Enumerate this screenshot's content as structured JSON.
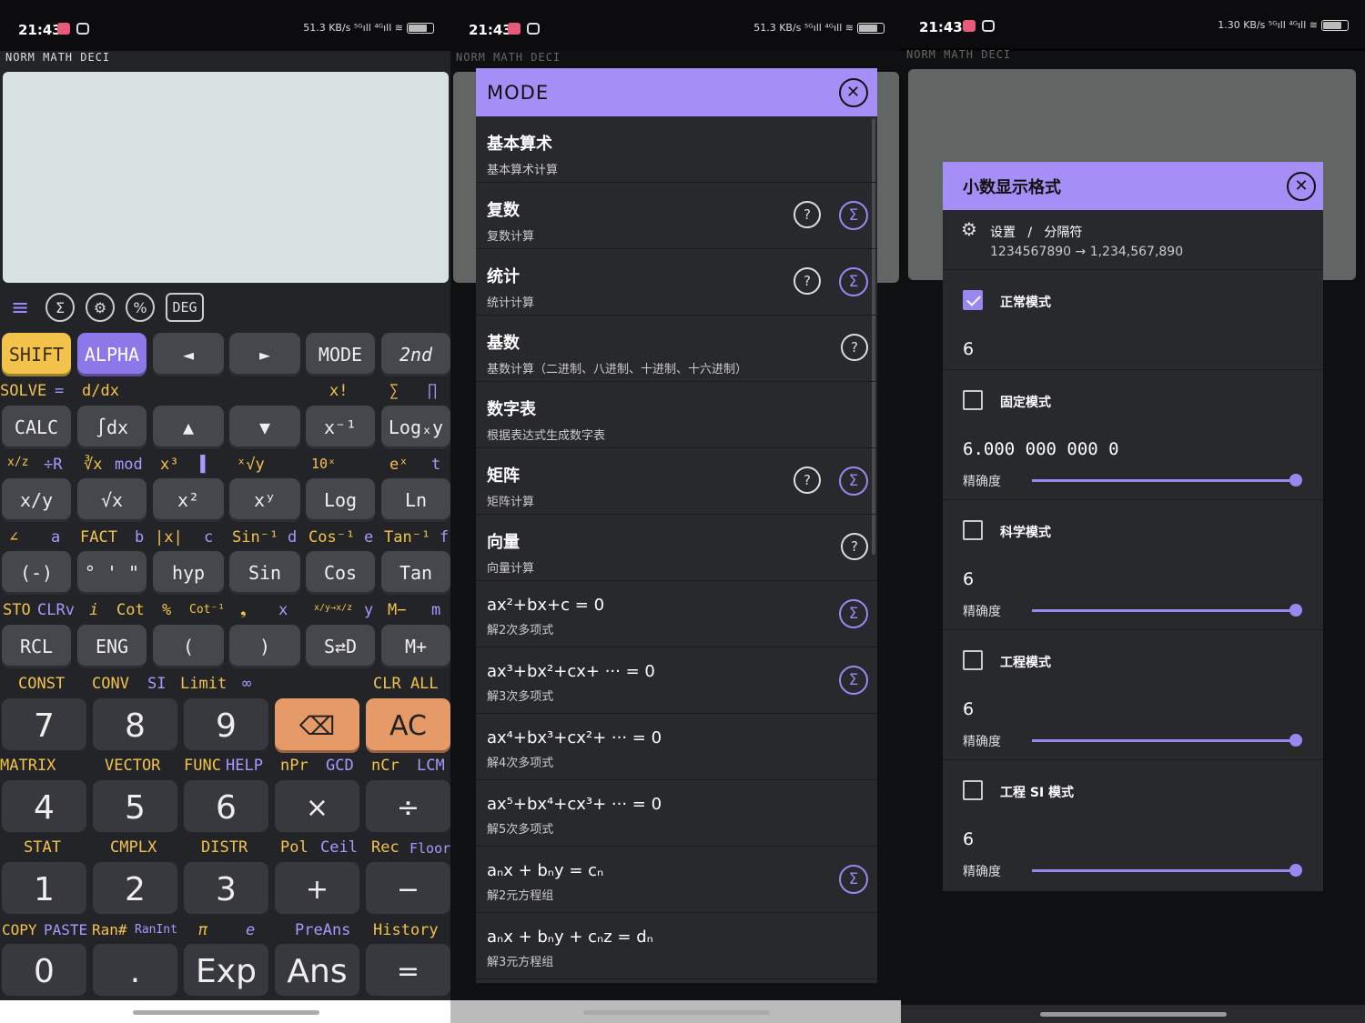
{
  "status": {
    "time": "21:43",
    "speed1": "51.3 KB/s",
    "speed3": "1.30 KB/s",
    "signal": "⁵ᴳıll ⁴ᴳıll ≋",
    "battery": "64"
  },
  "modes": "NORM  MATH  DECI",
  "colors": {
    "accent": "#a58ef5",
    "shift": "#f3c24b",
    "delete": "#e69a67",
    "alpha": "#8c78e8"
  },
  "toolbar": {
    "menu_icon": "menu-icon",
    "sigma_icon": "sigma-icon",
    "gear_icon": "gear-icon",
    "percent_icon": "percent-icon",
    "deg": "DEG"
  },
  "row1": {
    "shift": "SHIFT",
    "alpha": "ALPHA",
    "left": "◄",
    "right": "►",
    "mode": "MODE",
    "second": "2nd"
  },
  "row1_labels": {
    "solve": "SOLVE",
    "eq": "=",
    "ddx": "d/dx",
    "fact": "x!",
    "sum": "∑",
    "prod": "∏"
  },
  "row2": {
    "calc": "CALC",
    "int": "∫dx",
    "up": "▲",
    "down": "▼",
    "inv": "x⁻¹",
    "log": "Logₓy"
  },
  "row2_labels": {
    "frac": "x/z",
    "divr": "÷R",
    "cbrt": "∛x",
    "mod": "mod",
    "x3": "x³",
    "bar": "▐",
    "xrt": "ˣ√y",
    "ten": "10ˣ",
    "ex": "eˣ",
    "t": "t"
  },
  "row3": {
    "frac": "x/y",
    "sqrt": "√x",
    "sq": "x²",
    "pow": "xʸ",
    "log": "Log",
    "ln": "Ln"
  },
  "row3_labels": {
    "ang": "∠",
    "a": "a",
    "fact": "FACT",
    "b": "b",
    "abs": "|x|",
    "c": "c",
    "asin": "Sin⁻¹",
    "d": "d",
    "acos": "Cos⁻¹",
    "e": "e",
    "atan": "Tan⁻¹",
    "f": "f"
  },
  "row4": {
    "neg": "(-)",
    "deg": "° ' \"",
    "hyp": "hyp",
    "sin": "Sin",
    "cos": "Cos",
    "tan": "Tan"
  },
  "row4_labels": {
    "sto": "STO",
    "clrv": "CLRv",
    "i": "i",
    "cot": "Cot",
    "pct": "%",
    "acot": "Cot⁻¹",
    "comma": "❟",
    "x": "x",
    "conv": "x/y→x/z",
    "yv": "y",
    "mminus": "M−",
    "m": "m"
  },
  "row5": {
    "rcl": "RCL",
    "eng": "ENG",
    "lp": "(",
    "rp": ")",
    "sd": "S⇄D",
    "mplus": "M+"
  },
  "row5_labels": {
    "const": "CONST",
    "conv": "CONV",
    "si": "SI",
    "limit": "Limit",
    "inf": "∞",
    "clrall": "CLR ALL"
  },
  "num1": {
    "k7": "7",
    "k8": "8",
    "k9": "9",
    "del": "⌫",
    "ac": "AC"
  },
  "num1_labels": {
    "matrix": "MATRIX",
    "vector": "VECTOR",
    "func": "FUNC",
    "help": "HELP",
    "npr": "nPr",
    "gcd": "GCD",
    "ncr": "nCr",
    "lcm": "LCM"
  },
  "num2": {
    "k4": "4",
    "k5": "5",
    "k6": "6",
    "mul": "×",
    "div": "÷"
  },
  "num2_labels": {
    "stat": "STAT",
    "cmplx": "CMPLX",
    "distr": "DISTR",
    "pol": "Pol",
    "ceil": "Ceil",
    "rec": "Rec",
    "floor": "Floor"
  },
  "num3": {
    "k1": "1",
    "k2": "2",
    "k3": "3",
    "plus": "+",
    "minus": "−"
  },
  "num3_labels": {
    "copy": "COPY",
    "paste": "PASTE",
    "ran": "Ran#",
    "ranint": "RanInt",
    "pi": "π",
    "e": "e",
    "preans": "PreAns",
    "history": "History"
  },
  "num4": {
    "k0": "0",
    "dot": ".",
    "exp": "Exp",
    "ans": "Ans",
    "eq": "="
  },
  "mode_dialog": {
    "title": "MODE",
    "items": [
      {
        "title": "基本算术",
        "sub": "基本算术计算"
      },
      {
        "title": "复数",
        "sub": "复数计算"
      },
      {
        "title": "统计",
        "sub": "统计计算"
      },
      {
        "title": "基数",
        "sub": "基数计算（二进制、八进制、十进制、十六进制）"
      },
      {
        "title": "数字表",
        "sub": "根据表达式生成数字表"
      },
      {
        "title": "矩阵",
        "sub": "矩阵计算"
      },
      {
        "title": "向量",
        "sub": "向量计算"
      },
      {
        "title": "ax²+bx+c = 0",
        "sub": "解2次多项式"
      },
      {
        "title": "ax³+bx²+cx+ ··· = 0",
        "sub": "解3次多项式"
      },
      {
        "title": "ax⁴+bx³+cx²+ ··· = 0",
        "sub": "解4次多项式"
      },
      {
        "title": "ax⁵+bx⁴+cx³+ ··· = 0",
        "sub": "解5次多项式"
      },
      {
        "title": "aₙx + bₙy = cₙ",
        "sub": "解2元方程组"
      },
      {
        "title": "aₙx + bₙy + cₙz = dₙ",
        "sub": "解3元方程组"
      }
    ]
  },
  "decimal_dialog": {
    "title": "小数显示格式",
    "settings_path": "设置   /   分隔符",
    "separator_example": "1234567890 → 1,234,567,890",
    "precision_label": "精确度",
    "options": [
      {
        "label": "正常模式",
        "value": "6",
        "checked": true,
        "precision": 1.0
      },
      {
        "label": "固定模式",
        "value": "6.000 000 000 0",
        "checked": false,
        "precision": 1.0
      },
      {
        "label": "科学模式",
        "value": "6",
        "checked": false,
        "precision": 1.0
      },
      {
        "label": "工程模式",
        "value": "6",
        "checked": false,
        "precision": 1.0
      },
      {
        "label": "工程 SI 模式",
        "value": "6",
        "checked": false,
        "precision": 1.0
      }
    ]
  }
}
